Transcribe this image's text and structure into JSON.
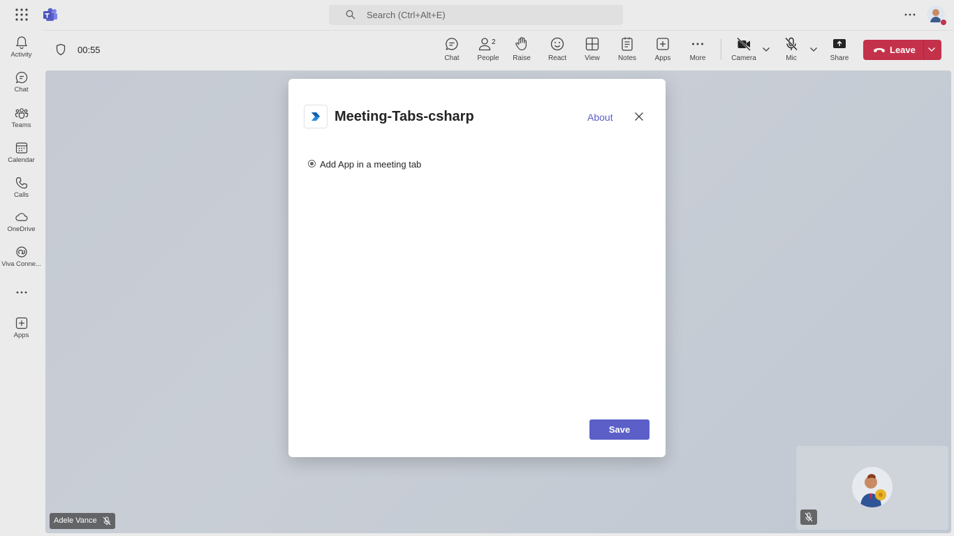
{
  "topbar": {
    "search_placeholder": "Search (Ctrl+Alt+E)"
  },
  "rail": {
    "items": [
      {
        "label": "Activity",
        "icon": "bell-icon"
      },
      {
        "label": "Chat",
        "icon": "chat-icon"
      },
      {
        "label": "Teams",
        "icon": "teams-icon"
      },
      {
        "label": "Calendar",
        "icon": "calendar-icon"
      },
      {
        "label": "Calls",
        "icon": "phone-icon"
      },
      {
        "label": "OneDrive",
        "icon": "cloud-icon"
      },
      {
        "label": "Viva Conne...",
        "icon": "viva-icon"
      },
      {
        "label": "Apps",
        "icon": "apps-icon"
      }
    ]
  },
  "meeting": {
    "timer": "00:55",
    "people_count": "2",
    "toolbar": {
      "chat": "Chat",
      "people": "People",
      "raise": "Raise",
      "react": "React",
      "view": "View",
      "notes": "Notes",
      "apps": "Apps",
      "more": "More",
      "camera": "Camera",
      "mic": "Mic",
      "share": "Share"
    },
    "leave_label": "Leave",
    "participant_name": "Adele Vance"
  },
  "dialog": {
    "title": "Meeting-Tabs-csharp",
    "about_label": "About",
    "option_label": "Add App in a meeting tab",
    "option_selected": true,
    "save_label": "Save"
  },
  "colors": {
    "accent": "#5b5fc7",
    "leave": "#c4314b",
    "chrome": "#ebebeb"
  }
}
